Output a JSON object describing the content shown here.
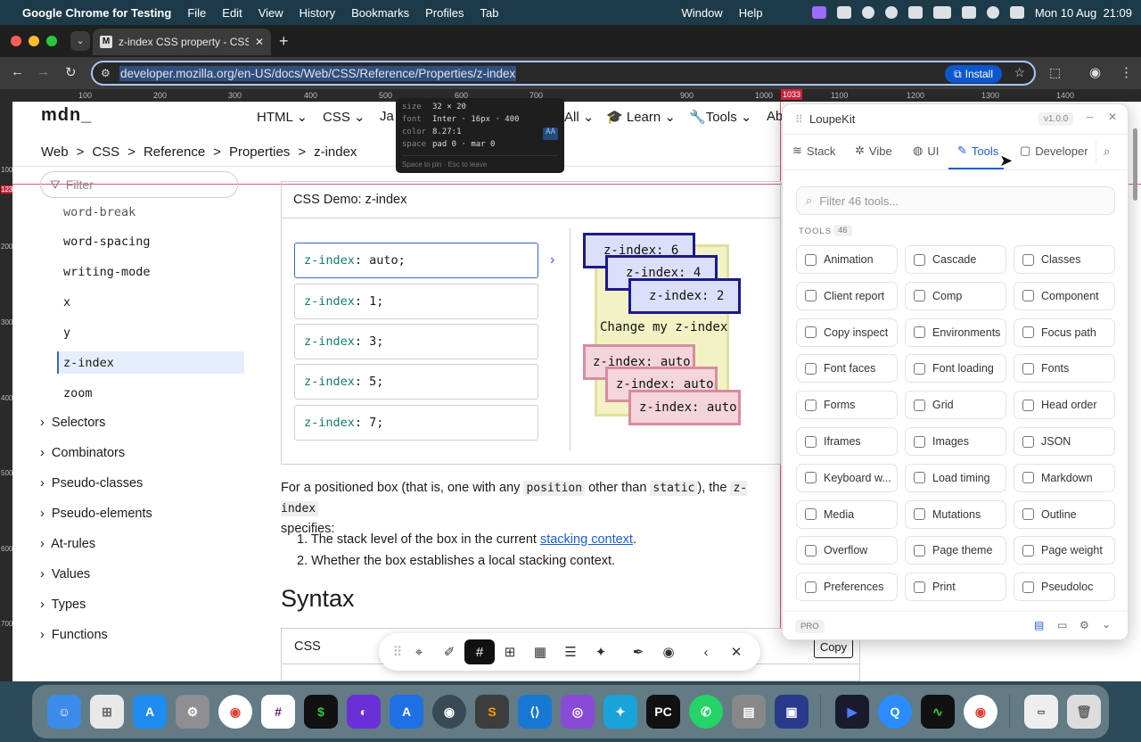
{
  "menubar": {
    "app": "Google Chrome for Testing",
    "items": [
      "File",
      "Edit",
      "View",
      "History",
      "Bookmarks",
      "Profiles",
      "Tab",
      "Window",
      "Help"
    ],
    "datetime": "Mon 10 Aug  21:09"
  },
  "browser": {
    "tab_title": "z-index CSS property - CSS |",
    "url": "developer.mozilla.org/en-US/docs/Web/CSS/Reference/Properties/z-index",
    "install_label": "Install"
  },
  "ruler": {
    "marks": [
      "100",
      "200",
      "300",
      "400",
      "500",
      "600",
      "700",
      "900",
      "1000",
      "1033",
      "1100",
      "1200",
      "1300",
      "1400"
    ],
    "vmarks": [
      "100",
      "123",
      "200",
      "300",
      "400",
      "500",
      "600",
      "700"
    ]
  },
  "tooltip": {
    "size_label": "size",
    "size": "32 × 20",
    "font_label": "font",
    "font": "Inter · 16px · 400",
    "color_label": "color",
    "color": "8.27:1",
    "color_badge": "AA",
    "space_label": "space",
    "space": "pad 0 · mar 0",
    "hint": "Space to pin · Esc to leave"
  },
  "mdn": {
    "logo": "mdn_",
    "nav": [
      "HTML",
      "CSS",
      "Ja",
      "All",
      "Learn",
      "Tools",
      "Ab"
    ],
    "breadcrumb": [
      "Web",
      "CSS",
      "Reference",
      "Properties",
      "z-index"
    ],
    "filter_placeholder": "Filter",
    "sidebar_items": [
      "word-break",
      "word-spacing",
      "writing-mode",
      "x",
      "y",
      "z-index",
      "zoom"
    ],
    "sidebar_sections": [
      "Selectors",
      "Combinators",
      "Pseudo-classes",
      "Pseudo-elements",
      "At-rules",
      "Values",
      "Types",
      "Functions"
    ],
    "demo_title": "CSS Demo: z-index",
    "demo_options": [
      {
        "prop": "z-index",
        "val": "auto;"
      },
      {
        "prop": "z-index",
        "val": "1;"
      },
      {
        "prop": "z-index",
        "val": "3;"
      },
      {
        "prop": "z-index",
        "val": "5;"
      },
      {
        "prop": "z-index",
        "val": "7;"
      }
    ],
    "demo_boxes": [
      "z-index: 6",
      "z-index: 4",
      "z-index: 2",
      "Change my z-index",
      "z-index: auto",
      "z-index: auto",
      "z-index: auto"
    ],
    "para_a": "For a positioned box (that is, one with any ",
    "code_position": "position",
    "para_b": " other than ",
    "code_static": "static",
    "para_c": "), the ",
    "code_zindex": "z-index",
    "para_d": "specifies:",
    "list": [
      "The stack level of the box in the current ",
      "Whether the box establishes a local stacking context."
    ],
    "link": "stacking context",
    "list_end": ".",
    "syntax_heading": "Syntax",
    "code_label": "CSS",
    "copy_label": "Copy"
  },
  "loupe": {
    "title": "LoupeKit",
    "version": "v1.0.0",
    "tabs": [
      "Stack",
      "Vibe",
      "UI",
      "Tools",
      "Developer"
    ],
    "search_placeholder": "Filter 46 tools...",
    "section_label": "TOOLS",
    "count": "46",
    "tools": [
      "Animation",
      "Cascade",
      "Classes",
      "Client report",
      "Comp",
      "Component",
      "Copy inspect",
      "Environments",
      "Focus path",
      "Font faces",
      "Font loading",
      "Fonts",
      "Forms",
      "Grid",
      "Head order",
      "Iframes",
      "Images",
      "JSON",
      "Keyboard w...",
      "Load timing",
      "Markdown",
      "Media",
      "Mutations",
      "Outline",
      "Overflow",
      "Page theme",
      "Page weight",
      "Preferences",
      "Print",
      "Pseudoloc"
    ],
    "pro": "PRO"
  }
}
